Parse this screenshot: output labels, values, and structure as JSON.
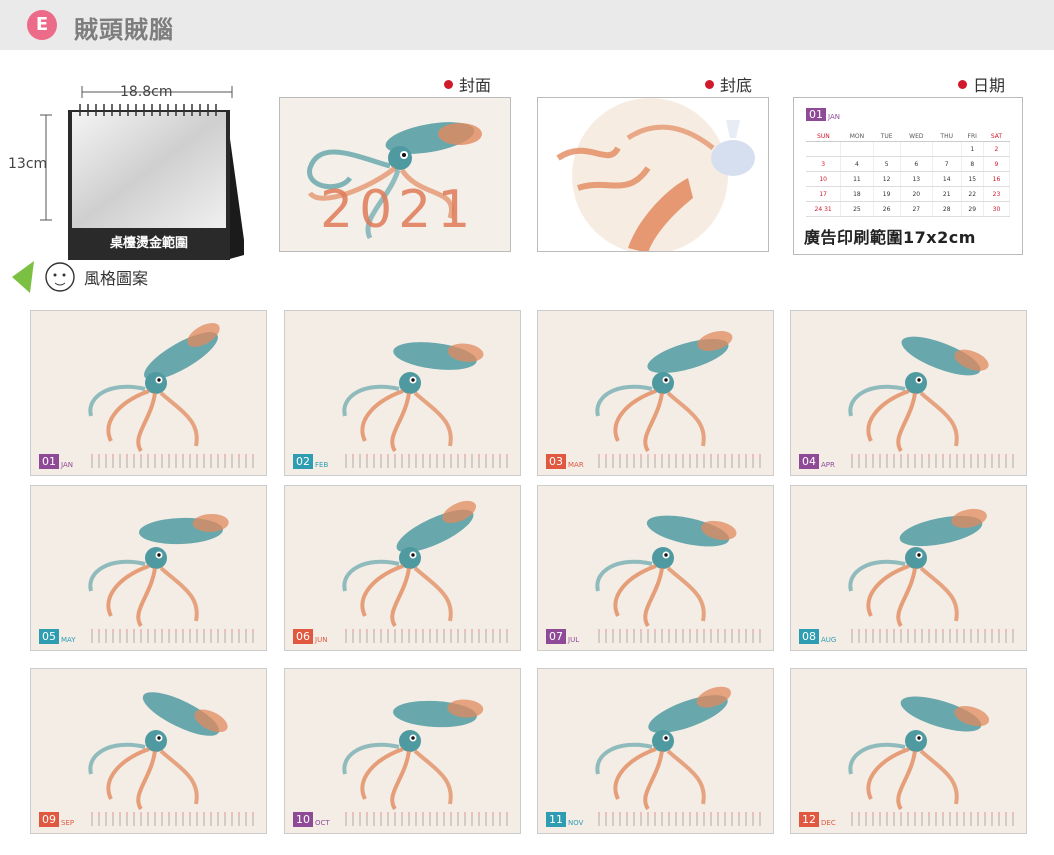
{
  "header": {
    "badge": "E",
    "title": "賊頭賊腦"
  },
  "desk": {
    "width_label": "18.8cm",
    "height_label": "13cm",
    "stamp_label": "桌檯燙金範圍"
  },
  "labels": {
    "front_cover": "封面",
    "back_cover": "封底",
    "date": "日期"
  },
  "date_card": {
    "month_num": "01",
    "month_name": "JAN",
    "caption": "廣告印刷範圍17x2cm",
    "weekdays": [
      "SUN",
      "MON",
      "TUE",
      "WED",
      "THU",
      "FRI",
      "SAT"
    ],
    "rows": [
      [
        "",
        "",
        "",
        "",
        "",
        "1",
        "2"
      ],
      [
        "3",
        "4",
        "5",
        "6",
        "7",
        "8",
        "9"
      ],
      [
        "10",
        "11",
        "12",
        "13",
        "14",
        "15",
        "16"
      ],
      [
        "17",
        "18",
        "19",
        "20",
        "21",
        "22",
        "23"
      ],
      [
        "24 31",
        "25",
        "26",
        "27",
        "28",
        "29",
        "30"
      ]
    ]
  },
  "front_cover_text": "2021",
  "style_label": "風格圖案",
  "months": [
    {
      "num": "01",
      "name": "JAN",
      "color": "#8e4a97"
    },
    {
      "num": "02",
      "name": "FEB",
      "color": "#2e9db1"
    },
    {
      "num": "03",
      "name": "MAR",
      "color": "#e0583f"
    },
    {
      "num": "04",
      "name": "APR",
      "color": "#8e4a97"
    },
    {
      "num": "05",
      "name": "MAY",
      "color": "#2e9db1"
    },
    {
      "num": "06",
      "name": "JUN",
      "color": "#e0583f"
    },
    {
      "num": "07",
      "name": "JUL",
      "color": "#8e4a97"
    },
    {
      "num": "08",
      "name": "AUG",
      "color": "#2e9db1"
    },
    {
      "num": "09",
      "name": "SEP",
      "color": "#e0583f"
    },
    {
      "num": "10",
      "name": "OCT",
      "color": "#8e4a97"
    },
    {
      "num": "11",
      "name": "NOV",
      "color": "#2e9db1"
    },
    {
      "num": "12",
      "name": "DEC",
      "color": "#e0583f"
    }
  ],
  "colors": {
    "squid_teal": "#4f9aa0",
    "squid_orange": "#e28a5e",
    "accent_red": "#d0192b"
  }
}
